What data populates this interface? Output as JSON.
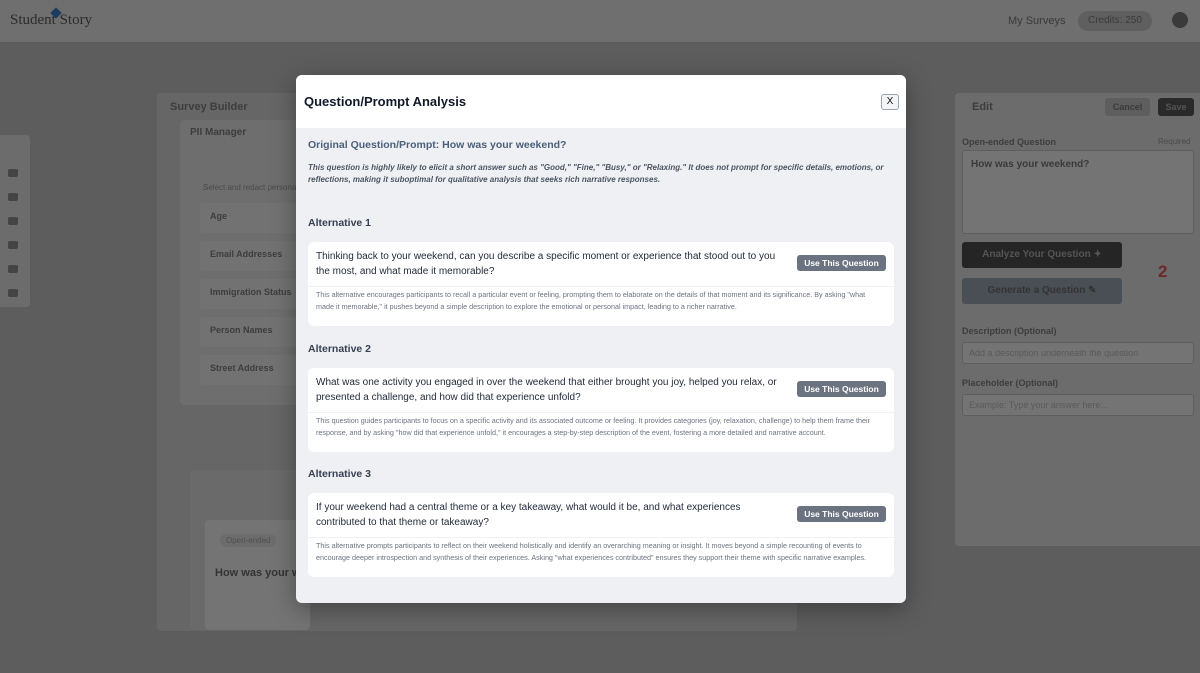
{
  "app": {
    "logo": "Student Story",
    "nav_link": "My Surveys",
    "credits": "Credits: 250"
  },
  "builder": {
    "title": "Survey Builder",
    "pii_title": "PII Manager",
    "pii_subtitle": "Select and redact personal",
    "pii_fields": [
      "Age",
      "Email Addresses",
      "Immigration Status",
      "Person Names",
      "Street Address"
    ],
    "preview_label": "Open-ended",
    "preview_text": "How was your w"
  },
  "edit_panel": {
    "title": "Edit",
    "cancel_label": "Cancel",
    "save_label": "Save",
    "question_label": "Open-ended Question",
    "required_label": "Required",
    "question_value": "How was your weekend?",
    "analyze_label": "Analyze Your Question ✦",
    "generate_label": "Generate a Question ✎",
    "score": "2",
    "description_label": "Description (Optional)",
    "description_placeholder": "Add a description underneath the question",
    "placeholder_label": "Placeholder (Optional)",
    "placeholder_placeholder": "Example: Type your answer here..."
  },
  "modal": {
    "title": "Question/Prompt Analysis",
    "close_label": "X",
    "original_heading": "Original Question/Prompt: How was your weekend?",
    "original_explanation": "This question is highly likely to elicit a short answer such as \"Good,\" \"Fine,\" \"Busy,\" or \"Relaxing.\" It does not prompt for specific details, emotions, or reflections, making it suboptimal for qualitative analysis that seeks rich narrative responses.",
    "use_button_label": "Use This Question",
    "alternatives": [
      {
        "heading": "Alternative 1",
        "question": "Thinking back to your weekend, can you describe a specific moment or experience that stood out to you the most, and what made it memorable?",
        "explanation": "This alternative encourages participants to recall a particular event or feeling, prompting them to elaborate on the details of that moment and its significance. By asking \"what made it memorable,\" it pushes beyond a simple description to explore the emotional or personal impact, leading to a richer narrative."
      },
      {
        "heading": "Alternative 2",
        "question": "What was one activity you engaged in over the weekend that either brought you joy, helped you relax, or presented a challenge, and how did that experience unfold?",
        "explanation": "This question guides participants to focus on a specific activity and its associated outcome or feeling. It provides categories (joy, relaxation, challenge) to help them frame their response, and by asking \"how did that experience unfold,\" it encourages a step-by-step description of the event, fostering a more detailed and narrative account."
      },
      {
        "heading": "Alternative 3",
        "question": "If your weekend had a central theme or a key takeaway, what would it be, and what experiences contributed to that theme or takeaway?",
        "explanation": "This alternative prompts participants to reflect on their weekend holistically and identify an overarching meaning or insight. It moves beyond a simple recounting of events to encourage deeper introspection and synthesis of their experiences. Asking \"what experiences contributed\" ensures they support their theme with specific narrative examples."
      }
    ]
  }
}
